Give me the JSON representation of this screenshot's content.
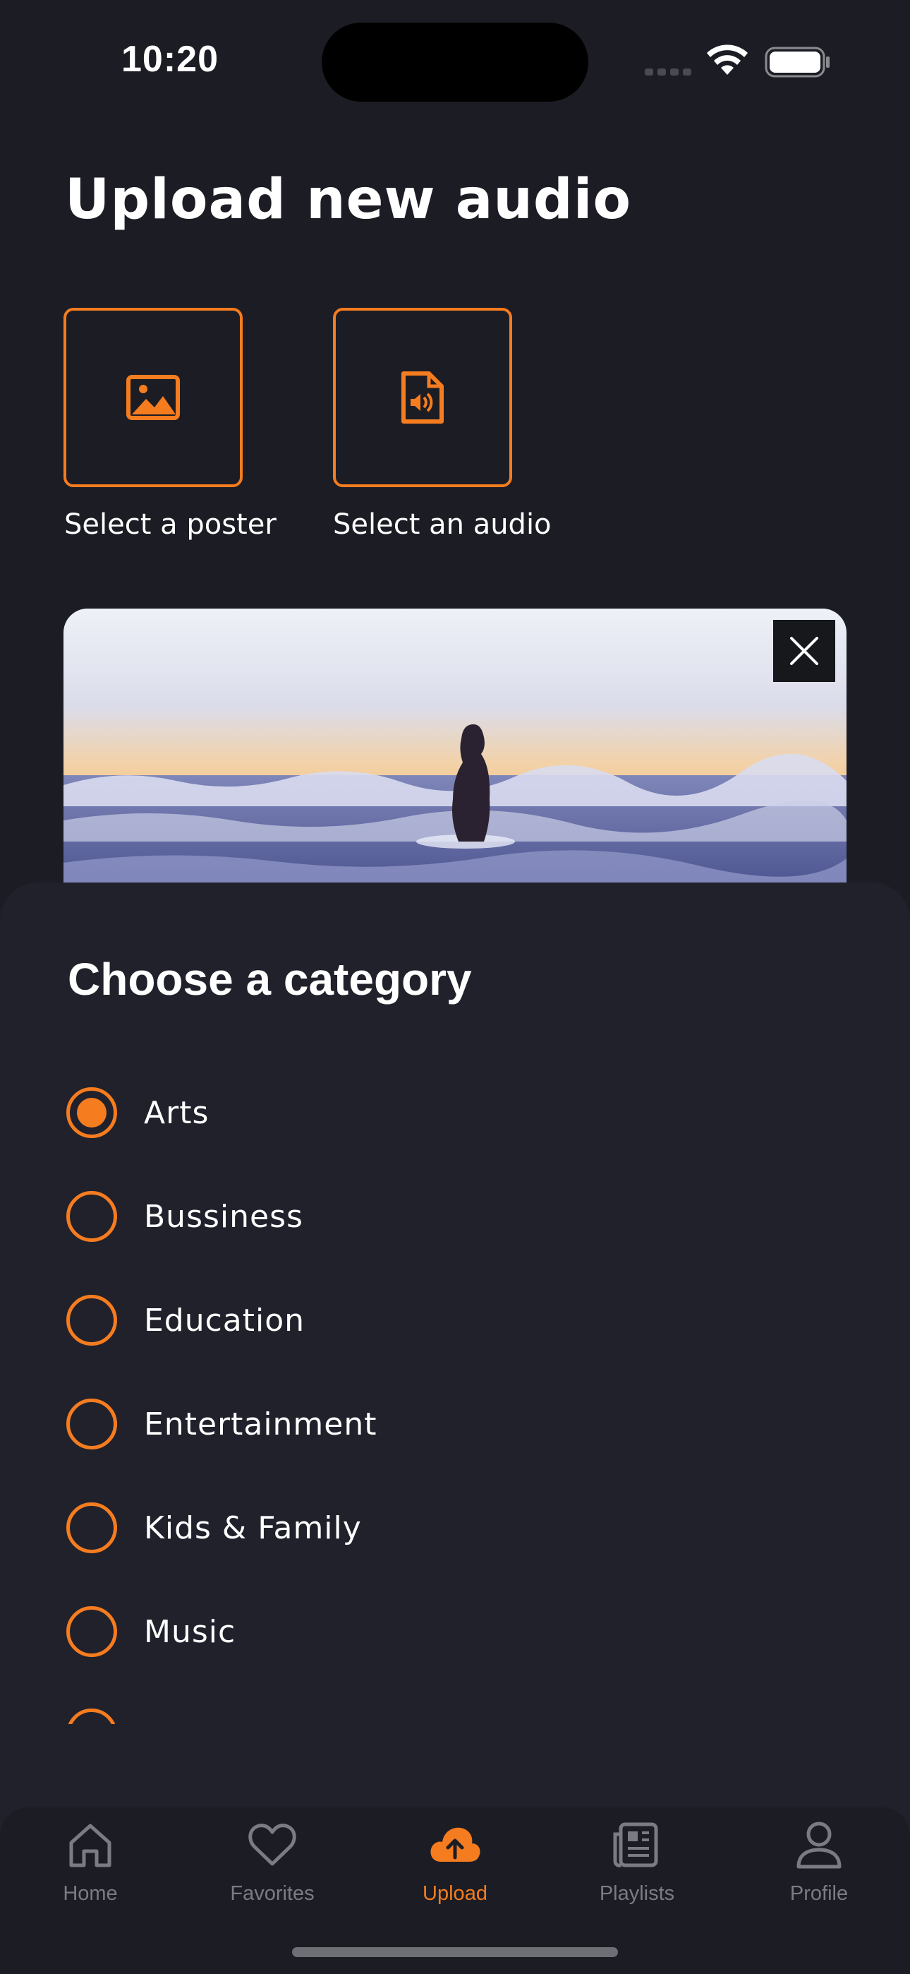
{
  "status_bar": {
    "time": "10:20"
  },
  "page": {
    "title": "Upload new audio"
  },
  "pickers": {
    "poster_label": "Select a poster",
    "audio_label": "Select an audio"
  },
  "category_sheet": {
    "title": "Choose a category",
    "selected": "Arts",
    "options": [
      {
        "label": "Arts",
        "selected": true
      },
      {
        "label": "Bussiness",
        "selected": false
      },
      {
        "label": "Education",
        "selected": false
      },
      {
        "label": "Entertainment",
        "selected": false
      },
      {
        "label": "Kids & Family",
        "selected": false
      },
      {
        "label": "Music",
        "selected": false
      }
    ]
  },
  "tabbar": {
    "items": [
      {
        "label": "Home",
        "icon": "home-icon",
        "active": false
      },
      {
        "label": "Favorites",
        "icon": "heart-icon",
        "active": false
      },
      {
        "label": "Upload",
        "icon": "cloud-upload-icon",
        "active": true
      },
      {
        "label": "Playlists",
        "icon": "playlists-icon",
        "active": false
      },
      {
        "label": "Profile",
        "icon": "profile-icon",
        "active": false
      }
    ]
  },
  "colors": {
    "accent": "#f57c1f",
    "background": "#1c1d24",
    "sheet": "#20212b",
    "inactive": "#7b7c83"
  }
}
